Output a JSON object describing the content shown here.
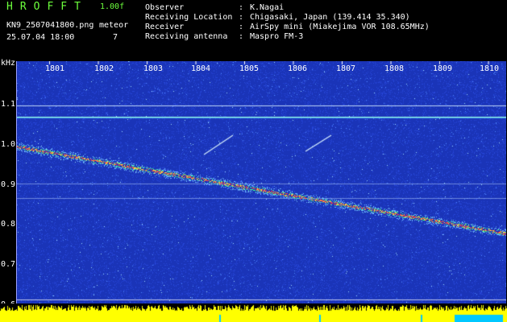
{
  "header": {
    "brand": "HROFFT",
    "version": "1.00f",
    "filename": "KN9_2507041800.png",
    "datetime": "25.07.04 18:00",
    "mode_label": "meteor",
    "count": "7",
    "meta": [
      {
        "label": "Observer",
        "value": "K.Nagai"
      },
      {
        "label": "Receiving Location",
        "value": "Chigasaki, Japan (139.414 35.340)"
      },
      {
        "label": "Receiver",
        "value": "AirSpy mini (Miakejima VOR 108.65MHz)"
      },
      {
        "label": "Receiving antenna",
        "value": "Maspro FM-3"
      }
    ]
  },
  "axes": {
    "y_unit": "kHz",
    "y_ticks": [
      "1.1",
      "1.0",
      "0.9",
      "0.8",
      "0.7",
      "0.6"
    ],
    "x_ticks": [
      "1801",
      "1802",
      "1803",
      "1804",
      "1805",
      "1806",
      "1807",
      "1808",
      "1809",
      "1810"
    ]
  },
  "colors": {
    "background": "#1a34b8",
    "noise": "#3a6cff",
    "carrier": "#9fffe0",
    "trace_hot": "#ff3a3a",
    "trace_warm": "#ffd23c",
    "level_bar": "#ffff00",
    "level_alt": "#00c8ff"
  }
}
